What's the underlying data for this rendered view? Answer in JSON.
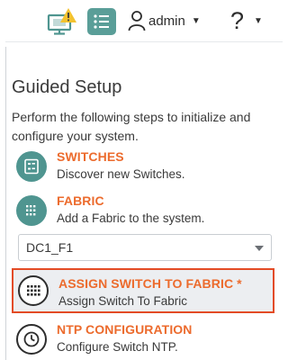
{
  "header": {
    "user": "admin",
    "help": "?"
  },
  "guided_setup": {
    "title": "Guided Setup",
    "intro": "Perform the following steps to initialize and configure your system."
  },
  "steps": [
    {
      "icon": "switch-icon",
      "title": "SWITCHES",
      "desc": "Discover new Switches."
    },
    {
      "icon": "fabric-grid-icon",
      "title": "FABRIC",
      "desc": "Add a Fabric to the system."
    },
    {
      "icon": "fabric-grid-icon",
      "title": "ASSIGN SWITCH TO FABRIC *",
      "desc": "Assign Switch To Fabric"
    },
    {
      "icon": "clock-icon",
      "title": "NTP CONFIGURATION",
      "desc": "Configure Switch NTP."
    }
  ],
  "fabric_select": {
    "value": "DC1_F1"
  },
  "colors": {
    "accent": "#ec6b2d",
    "teal": "#4f9590",
    "highlight_border": "#e34b25"
  }
}
